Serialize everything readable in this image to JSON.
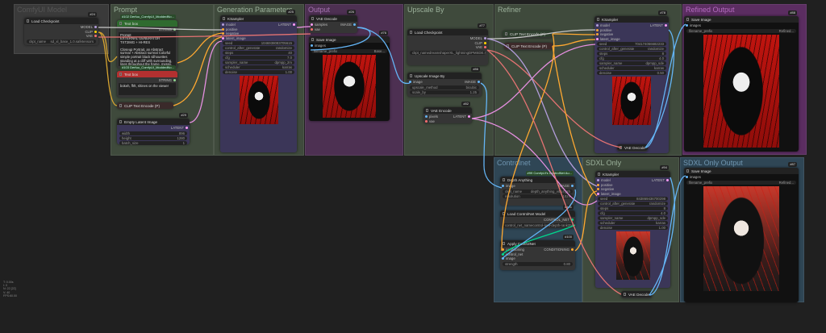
{
  "groups": [
    {
      "id": "comfy",
      "title": "ComfyUI Model",
      "color": "#3a3a3a",
      "tcolor": "#555"
    },
    {
      "id": "prompt",
      "title": "Prompt",
      "color": "#3f4a3c",
      "tcolor": "#9bb09a"
    },
    {
      "id": "gen",
      "title": "Generation Parameters",
      "color": "#3f4a3c",
      "tcolor": "#9bb09a"
    },
    {
      "id": "output",
      "title": "Output",
      "color": "#4d3052",
      "tcolor": "#a472b0"
    },
    {
      "id": "upscale",
      "title": "Upscale By",
      "color": "#3f4a3c",
      "tcolor": "#9bb09a"
    },
    {
      "id": "refiner",
      "title": "Refiner",
      "color": "#3f4a3c",
      "tcolor": "#9bb09a"
    },
    {
      "id": "refined",
      "title": "Refined Output",
      "color": "#5b2d61",
      "tcolor": "#b46ac0"
    },
    {
      "id": "controlnet",
      "title": "Controlnet",
      "color": "#2f4655",
      "tcolor": "#6f95b0"
    },
    {
      "id": "sdxl",
      "title": "SDXL Only",
      "color": "#3f4a3c",
      "tcolor": "#9bb09a"
    },
    {
      "id": "sdxlout",
      "title": "SDXL Only Output",
      "color": "#2f4655",
      "tcolor": "#6f95b0"
    }
  ],
  "nodes": [
    {
      "key": "n24",
      "badge": "#24",
      "title": "Load Checkpoint",
      "outputs": [
        [
          "MODEL",
          "#b39ddb"
        ],
        [
          "CLIP",
          "#ffd500"
        ],
        [
          "VAE",
          "#ff6e6e"
        ]
      ],
      "widgets": [
        [
          "ckpt_name",
          "sd_xl_base_1.0.safetensors"
        ]
      ]
    },
    {
      "key": "n102",
      "badge": "#102 Derfuu_ComfyUI_ModdedNo...",
      "badgeGreen": true,
      "title": "Text box",
      "titleColor": "#2f6b2f",
      "bodyColor": "#353535",
      "outputs": [
        [
          "STRING",
          "#8fd48f"
        ]
      ],
      "text": "Prompt\nEXTERNAL GENERATOR\nTXT2IMG + HI-RES\n\nCloseup Portrait, an Abstract surreal + Abstract surreal Colorful simple portrait black silhouettes standing at a cliff with surrounding, lines throughout the frame, messy, hair flown, fanart, made of lines, flowing lines, diagonal lines, Portrait"
    },
    {
      "key": "n103",
      "badge": "#103 Derfuu_ComfyUI_ModdedNo...",
      "badgeGreen": true,
      "title": "Text box",
      "titleColor": "#b33030",
      "outputs": [
        [
          "STRING",
          "#8fd48f"
        ]
      ],
      "text": "bokeh, ffrlt, shines on the viewer"
    },
    {
      "key": "clip1",
      "title": "CLIP Text Encode (P)",
      "titleColor": "#3a2a2a",
      "collapsed": true
    },
    {
      "key": "n29",
      "badge": "#29",
      "title": "Empty Latent Image",
      "bodyColor": "#3b3658",
      "outputs": [
        [
          "LATENT",
          "#ff9cf9"
        ]
      ],
      "widgets": [
        [
          "width",
          "896"
        ],
        [
          "height",
          "1280"
        ],
        [
          "batch_size",
          "1"
        ]
      ]
    },
    {
      "key": "n25",
      "badge": "#25",
      "title": "KSampler",
      "bodyColor": "#3b3658",
      "inputs": [
        [
          "model",
          "#b39ddb"
        ],
        [
          "positive",
          "#ffa931"
        ],
        [
          "negative",
          "#ffa931"
        ],
        [
          "latent_image",
          "#ff9cf9"
        ]
      ],
      "outputs": [
        [
          "LATENT",
          "#ff9cf9"
        ]
      ],
      "widgets": [
        [
          "seed",
          "1046938083705615"
        ],
        [
          "control_after_generate",
          "randomize"
        ],
        [
          "steps",
          "40"
        ],
        [
          "cfg",
          "7.0"
        ],
        [
          "sampler_name",
          "dpmpp_2m"
        ],
        [
          "scheduler",
          "karras"
        ],
        [
          "denoise",
          "1.00"
        ]
      ],
      "image": "base"
    },
    {
      "key": "n26",
      "badge": "#26",
      "title": "VAE Decode",
      "inputs": [
        [
          "samples",
          "#ff9cf9"
        ],
        [
          "vae",
          "#ff6e6e"
        ]
      ],
      "outputs": [
        [
          "IMAGE",
          "#64b5f6"
        ]
      ]
    },
    {
      "key": "n76",
      "badge": "#76",
      "title": "Save Image",
      "bodyColor": "#111",
      "inputs": [
        [
          "images",
          "#64b5f6"
        ]
      ],
      "widgets": [
        [
          "filename_prefix",
          "Base..."
        ]
      ],
      "image": "base"
    },
    {
      "key": "n77",
      "badge": "#77",
      "title": "Load Checkpoint",
      "outputs": [
        [
          "MODEL",
          "#b39ddb"
        ],
        [
          "CLIP",
          "#ffd500"
        ],
        [
          "VAE",
          "#ff6e6e"
        ]
      ],
      "widgets": [
        [
          "ckpt_name",
          "dreamshaperXL_lightningDPMSDE.safetensors"
        ]
      ]
    },
    {
      "key": "n86",
      "badge": "#86",
      "title": "Upscale Image By",
      "inputs": [
        [
          "image",
          "#64b5f6"
        ]
      ],
      "outputs": [
        [
          "IMAGE",
          "#64b5f6"
        ]
      ],
      "widgets": [
        [
          "upscale_method",
          "bicubic"
        ],
        [
          "scale_by",
          "1.25"
        ]
      ]
    },
    {
      "key": "n82",
      "badge": "#82",
      "title": "VAE Encode",
      "inputs": [
        [
          "pixels",
          "#64b5f6"
        ],
        [
          "vae",
          "#ff6e6e"
        ]
      ],
      "outputs": [
        [
          "LATENT",
          "#ff9cf9"
        ]
      ]
    },
    {
      "key": "clip2",
      "title": "CLIP Text Encode (P)",
      "titleColor": "#2d3d2d",
      "collapsed": true
    },
    {
      "key": "clip3",
      "title": "CLIP Text Encode (P)",
      "titleColor": "#3d2a2a",
      "collapsed": true
    },
    {
      "key": "n78",
      "badge": "#78",
      "title": "KSampler",
      "bodyColor": "#3b3658",
      "inputs": [
        [
          "model",
          "#b39ddb"
        ],
        [
          "positive",
          "#ffa931"
        ],
        [
          "negative",
          "#ffa931"
        ],
        [
          "latent_image",
          "#ff9cf9"
        ]
      ],
      "outputs": [
        [
          "LATENT",
          "#ff9cf9"
        ]
      ],
      "widgets": [
        [
          "seed",
          "704174066682233"
        ],
        [
          "control_after_generate",
          "randomize"
        ],
        [
          "steps",
          "8"
        ],
        [
          "cfg",
          "4.0"
        ],
        [
          "sampler_name",
          "dpmpp_sde"
        ],
        [
          "scheduler",
          "karras"
        ],
        [
          "denoise",
          "0.50"
        ]
      ],
      "image": "base"
    },
    {
      "key": "vd1",
      "title": "VAE Decode",
      "collapsed": true
    },
    {
      "key": "n88",
      "badge": "#88",
      "title": "Save Image",
      "bodyColor": "#111",
      "inputs": [
        [
          "images",
          "#64b5f6"
        ]
      ],
      "widgets": [
        [
          "filename_prefix",
          "Refined..."
        ]
      ],
      "image": "base"
    },
    {
      "key": "n99",
      "badge": "#99 ComfyUI's ControlNet Au...",
      "badgeGreen": true,
      "title": "Depth Anything",
      "inputs": [
        [
          "image",
          "#64b5f6"
        ]
      ],
      "outputs": [
        [
          "IMAGE",
          "#64b5f6"
        ]
      ],
      "widgets": [
        [
          "ckpt_name",
          "depth_anything_vitl14.pth"
        ],
        [
          "resolution",
          "1024"
        ]
      ]
    },
    {
      "key": "n101",
      "badge": "#101",
      "title": "Load ControlNet Model",
      "outputs": [
        [
          "CONTROL_NET",
          "#00d78d"
        ]
      ],
      "widgets": [
        [
          "control_net_name",
          "control-lora-depth-rank256.safetensors"
        ]
      ]
    },
    {
      "key": "n100",
      "badge": "#100",
      "title": "Apply ControlNet",
      "inputs": [
        [
          "conditioning",
          "#ffa931"
        ],
        [
          "control_net",
          "#00d78d"
        ],
        [
          "image",
          "#64b5f6"
        ]
      ],
      "outputs": [
        [
          "CONDITIONING",
          "#ffa931"
        ]
      ],
      "widgets": [
        [
          "strength",
          "0.80"
        ]
      ]
    },
    {
      "key": "n94",
      "badge": "#94",
      "title": "KSampler",
      "bodyColor": "#3b3658",
      "inputs": [
        [
          "model",
          "#b39ddb"
        ],
        [
          "positive",
          "#ffa931"
        ],
        [
          "negative",
          "#ffa931"
        ],
        [
          "latent_image",
          "#ff9cf9"
        ]
      ],
      "outputs": [
        [
          "LATENT",
          "#ff9cf9"
        ]
      ],
      "widgets": [
        [
          "seed",
          "843869436700298"
        ],
        [
          "control_after_generate",
          "randomize"
        ],
        [
          "steps",
          "8"
        ],
        [
          "cfg",
          "4.0"
        ],
        [
          "sampler_name",
          "dpmpp_sde"
        ],
        [
          "scheduler",
          "karras"
        ],
        [
          "denoise",
          "1.00"
        ]
      ],
      "image": "sdxl"
    },
    {
      "key": "vd2",
      "title": "VAE Decode",
      "collapsed": true
    },
    {
      "key": "n87",
      "badge": "#87",
      "title": "Save Image",
      "bodyColor": "#111",
      "inputs": [
        [
          "images",
          "#64b5f6"
        ]
      ],
      "widgets": [
        [
          "filename_prefix",
          "Refined..."
        ]
      ],
      "image": "sdxl"
    }
  ],
  "stats": "T: 0.00s\nI: 0\nN: 22 [22]\nV: 40\nFPS:60.00"
}
